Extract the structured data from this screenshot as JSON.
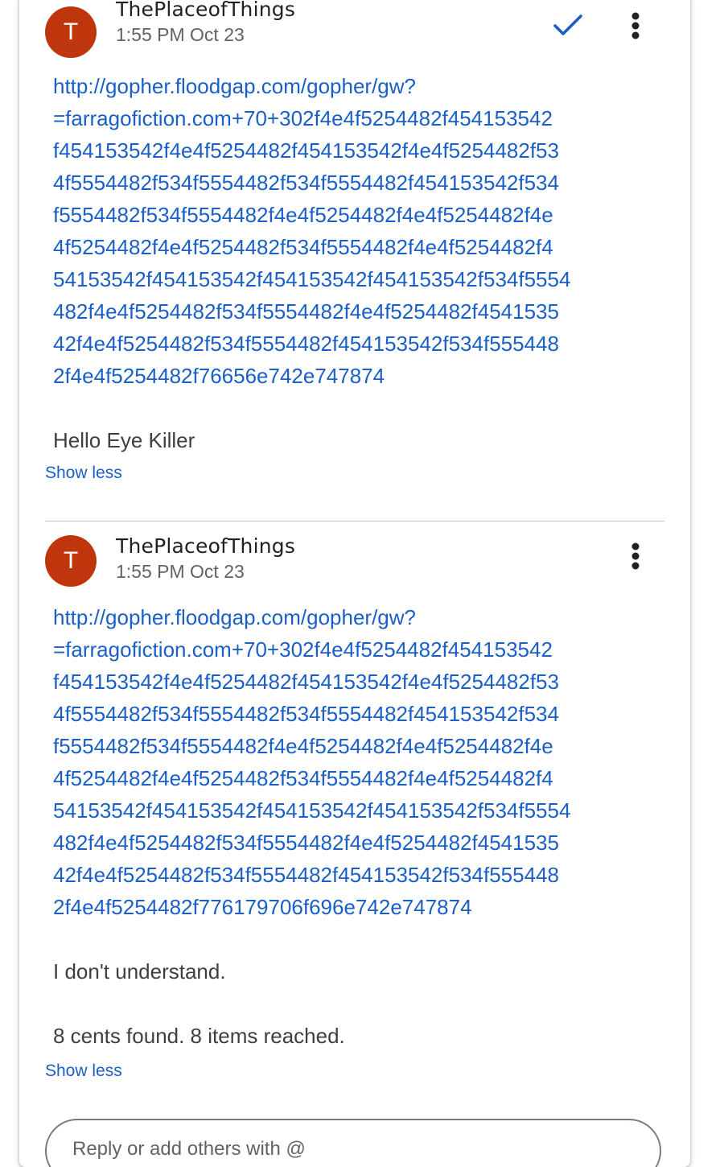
{
  "comments": [
    {
      "avatar_letter": "T",
      "author": "ThePlaceofThings",
      "time": "1:55 PM Oct 23",
      "resolved_icon": "check-icon",
      "menu_icon": "more-vert-icon",
      "link": "http://gopher.floodgap.com/gopher/gw?\n=farragofiction.com+70+302f4e4f5254482f454153542\nf454153542f4e4f5254482f454153542f4e4f5254482f53\n4f5554482f534f5554482f534f5554482f454153542f534\nf5554482f534f5554482f4e4f5254482f4e4f5254482f4e\n4f5254482f4e4f5254482f534f5554482f4e4f5254482f4\n54153542f454153542f454153542f454153542f534f5554\n482f4e4f5254482f534f5554482f4e4f5254482f4541535\n42f4e4f5254482f534f5554482f454153542f534f555448\n2f4e4f5254482f76656e742e747874",
      "message": "Hello Eye Killer",
      "show_less": "Show less"
    },
    {
      "avatar_letter": "T",
      "author": "ThePlaceofThings",
      "time": "1:55 PM Oct 23",
      "menu_icon": "more-vert-icon",
      "link": "http://gopher.floodgap.com/gopher/gw?\n=farragofiction.com+70+302f4e4f5254482f454153542\nf454153542f4e4f5254482f454153542f4e4f5254482f53\n4f5554482f534f5554482f534f5554482f454153542f534\nf5554482f534f5554482f4e4f5254482f4e4f5254482f4e\n4f5254482f4e4f5254482f534f5554482f4e4f5254482f4\n54153542f454153542f454153542f454153542f534f5554\n482f4e4f5254482f534f5554482f4e4f5254482f4541535\n42f4e4f5254482f534f5554482f454153542f534f555448\n2f4e4f5254482f776179706f696e742e747874",
      "message": "I don't understand.",
      "message2": "8 cents found. 8 items reached.",
      "show_less": "Show less"
    }
  ],
  "reply": {
    "placeholder": "Reply or add others with @"
  },
  "colors": {
    "avatar": "#c0360c",
    "link": "#1a5fc8",
    "check": "#1a5fc8"
  }
}
